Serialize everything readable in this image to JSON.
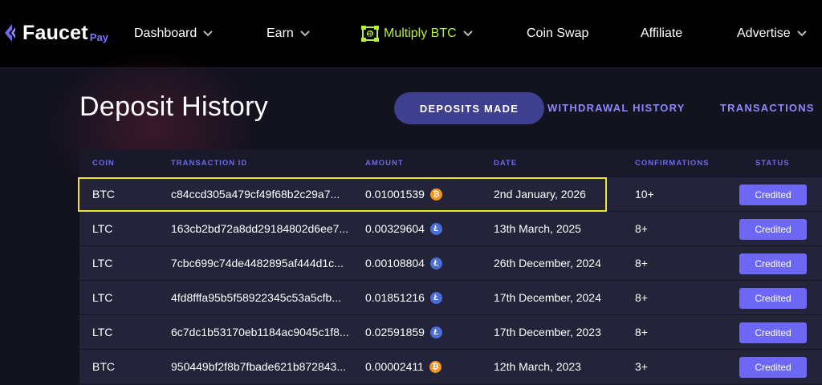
{
  "brand": {
    "name": "Faucet",
    "suffix": "Pay"
  },
  "nav": {
    "items": [
      {
        "label": "Dashboard",
        "has_dropdown": true,
        "active": false
      },
      {
        "label": "Earn",
        "has_dropdown": true,
        "active": false
      },
      {
        "label": "Multiply BTC",
        "has_dropdown": true,
        "active": true
      },
      {
        "label": "Coin Swap",
        "has_dropdown": false,
        "active": false
      },
      {
        "label": "Affiliate",
        "has_dropdown": false,
        "active": false
      },
      {
        "label": "Advertise",
        "has_dropdown": true,
        "active": false
      }
    ],
    "active_color": "#b7f03a"
  },
  "page": {
    "title": "Deposit History"
  },
  "tabs": [
    {
      "label": "DEPOSITS MADE",
      "selected": true
    },
    {
      "label": "WITHDRAWAL HISTORY",
      "selected": false
    },
    {
      "label": "TRANSACTIONS",
      "selected": false
    }
  ],
  "table": {
    "columns": [
      "COIN",
      "TRANSACTION ID",
      "AMOUNT",
      "DATE",
      "CONFIRMATIONS",
      "STATUS"
    ],
    "rows": [
      {
        "coin": "BTC",
        "txid": "c84ccd305a479cf49f68b2c29a7...",
        "amount": "0.01001539",
        "coin_icon": "bitcoin-icon",
        "date": "2nd January, 2026",
        "confirmations": "10+",
        "status": "Credited"
      },
      {
        "coin": "LTC",
        "txid": "163cb2bd72a8dd29184802d6ee7...",
        "amount": "0.00329604",
        "coin_icon": "litecoin-icon",
        "date": "13th March, 2025",
        "confirmations": "8+",
        "status": "Credited"
      },
      {
        "coin": "LTC",
        "txid": "7cbc699c74de4482895af444d1c...",
        "amount": "0.00108804",
        "coin_icon": "litecoin-icon",
        "date": "26th December, 2024",
        "confirmations": "8+",
        "status": "Credited"
      },
      {
        "coin": "LTC",
        "txid": "4fd8fffa95b5f58922345c53a5cfb...",
        "amount": "0.01851216",
        "coin_icon": "litecoin-icon",
        "date": "17th December, 2024",
        "confirmations": "8+",
        "status": "Credited"
      },
      {
        "coin": "LTC",
        "txid": "6c7dc1b53170eb1184ac9045c1f8...",
        "amount": "0.02591859",
        "coin_icon": "litecoin-icon",
        "date": "17th December, 2023",
        "confirmations": "8+",
        "status": "Credited"
      },
      {
        "coin": "BTC",
        "txid": "950449bf2f8b7fbade621b872843...",
        "amount": "0.00002411",
        "coin_icon": "bitcoin-icon",
        "date": "12th March, 2023",
        "confirmations": "3+",
        "status": "Credited"
      }
    ]
  },
  "colors": {
    "accent": "#6c68f5",
    "highlight": "#f0e23a",
    "bitcoin": "#f7931a",
    "litecoin": "#4a6ed8"
  }
}
